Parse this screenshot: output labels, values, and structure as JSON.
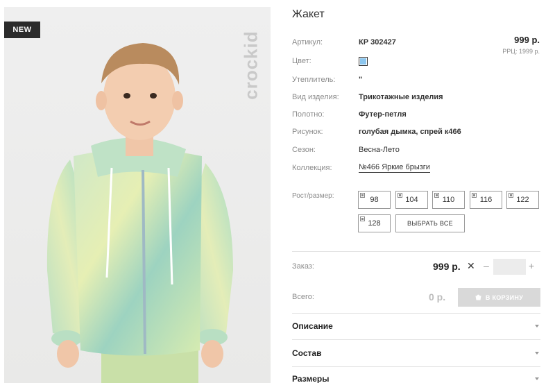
{
  "product": {
    "badge": "NEW",
    "brand": "crockid",
    "title": "Жакет",
    "price": "999 р.",
    "rrc": "РРЦ: 1999 р.",
    "swatch_color": "#8cc6ee"
  },
  "attributes": [
    {
      "label": "Артикул:",
      "value": "КР 302427"
    },
    {
      "label": "Цвет:",
      "value": ""
    },
    {
      "label": "Утеплитель:",
      "value": "\""
    },
    {
      "label": "Вид изделия:",
      "value": "Трикотажные изделия"
    },
    {
      "label": "Полотно:",
      "value": "Футер-петля"
    },
    {
      "label": "Рисунок:",
      "value": "голубая дымка, спрей к466"
    },
    {
      "label": "Сезон:",
      "value": "Весна-Лето"
    },
    {
      "label": "Коллекция:",
      "value": "№466 Яркие брызги"
    }
  ],
  "sizes": {
    "label": "Рост/размер:",
    "options": [
      "98",
      "104",
      "110",
      "116",
      "122",
      "128"
    ],
    "select_all": "ВЫБРАТЬ ВСЕ"
  },
  "order": {
    "label": "Заказ:",
    "price": "999 р.",
    "times": "✕",
    "minus": "–",
    "plus": "+",
    "qty_value": ""
  },
  "total": {
    "label": "Всего:",
    "price": "0 р.",
    "cart_button": "В КОРЗИНУ"
  },
  "accordion": [
    {
      "title": "Описание"
    },
    {
      "title": "Состав"
    },
    {
      "title": "Размеры"
    }
  ]
}
